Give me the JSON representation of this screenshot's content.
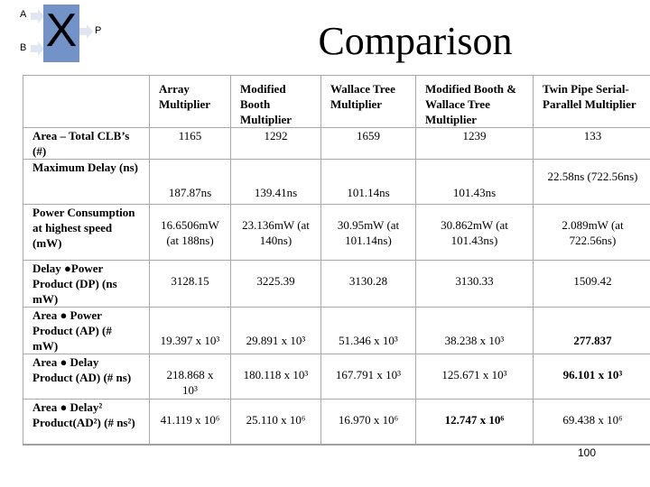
{
  "logo": {
    "symbol": "X",
    "input_a": "A",
    "input_b": "B",
    "output_p": "P",
    "box_color": "#7392c8"
  },
  "title": "Comparison",
  "table": {
    "columns": [
      "",
      "Array Multiplier",
      "Modified Booth Multiplier",
      "Wallace Tree Multiplier",
      "Modified Booth & Wallace Tree Multiplier",
      "Twin Pipe Serial-Parallel Multiplier"
    ],
    "rows": [
      {
        "label": "Area – Total CLB’s (#)",
        "values": [
          "1165",
          "1292",
          "1659",
          "1239",
          "133"
        ],
        "bold": [
          false,
          false,
          false,
          false,
          false
        ]
      },
      {
        "label": "Maximum Delay (ns)",
        "values": [
          "187.87ns",
          "139.41ns",
          "101.14ns",
          "101.43ns",
          "22.58ns (722.56ns)"
        ],
        "bold": [
          false,
          false,
          false,
          false,
          false
        ]
      },
      {
        "label": "Power Consumption at highest speed (mW)",
        "values": [
          "16.6506mW (at 188ns)",
          "23.136mW (at 140ns)",
          "30.95mW (at 101.14ns)",
          "30.862mW (at 101.43ns)",
          "2.089mW (at 722.56ns)"
        ],
        "bold": [
          false,
          false,
          false,
          false,
          false
        ]
      },
      {
        "label": "Delay ●Power Product (DP) (ns mW)",
        "values": [
          "3128.15",
          "3225.39",
          "3130.28",
          "3130.33",
          "1509.42"
        ],
        "bold": [
          false,
          false,
          false,
          false,
          false
        ]
      },
      {
        "label": "Area ● Power Product (AP) (# mW)",
        "values": [
          "19.397 x 10³",
          "29.891 x 10³",
          "51.346 x 10³",
          "38.238 x 10³",
          "277.837"
        ],
        "bold": [
          false,
          false,
          false,
          false,
          true
        ]
      },
      {
        "label": "Area ● Delay Product (AD) (# ns)",
        "values": [
          "218.868 x 10³",
          "180.118 x 10³",
          "167.791 x 10³",
          "125.671 x 10³",
          "96.101 x 10³"
        ],
        "bold": [
          false,
          false,
          false,
          false,
          true
        ]
      },
      {
        "label": "Area ● Delay² Product(AD²) (# ns²)",
        "values": [
          "41.119 x 10⁶",
          "25.110 x 10⁶",
          "16.970 x 10⁶",
          "12.747 x 10⁶",
          "69.438 x 10⁶"
        ],
        "bold": [
          false,
          false,
          false,
          true,
          false
        ]
      }
    ]
  },
  "page_number": "100"
}
